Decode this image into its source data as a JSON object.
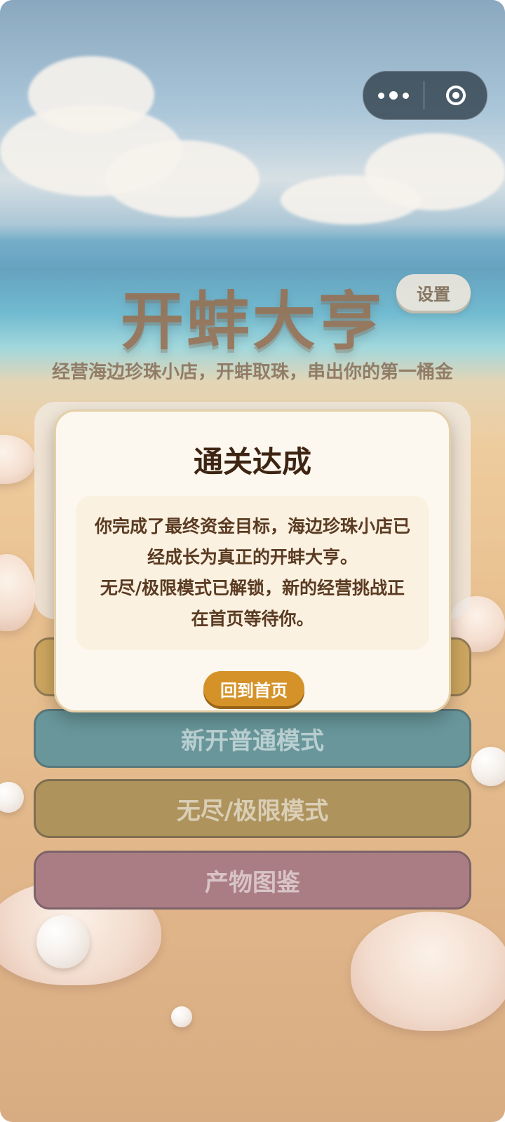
{
  "app": {
    "title": "开蚌大亨",
    "subtitle": "经营海边珍珠小店，开蚌取珠，串出你的第一桶金",
    "settings_label": "设置"
  },
  "menu": {
    "continue_label": "",
    "normal_label": "新开普通模式",
    "endless_label": "无尽/极限模式",
    "dex_label": "产物图鉴"
  },
  "modal": {
    "title": "通关达成",
    "lines": [
      "你完成了最终资金目标，海边珍珠小店已",
      "经成长为真正的开蚌大亨。",
      "无尽/极限模式已解锁，新的经营挑战正",
      "在首页等待你。"
    ],
    "button_label": "回到首页"
  },
  "capsule": {
    "more_icon": "more-dots-icon",
    "close_icon": "mini-program-close-icon"
  },
  "colors": {
    "title": "#6f3a12",
    "modal_button": "#d49228",
    "normal_button": "#2e6e74",
    "endless_button": "#8f6a1f",
    "dex_button": "#8a4c55"
  }
}
